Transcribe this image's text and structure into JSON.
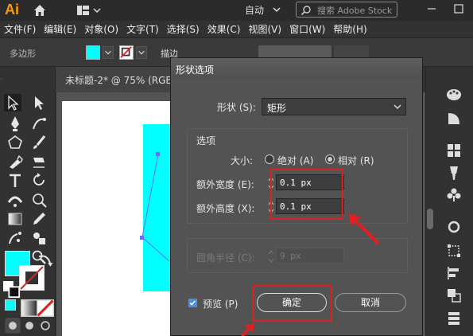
{
  "app": {
    "logo": "Ai",
    "workspace": "自动",
    "search_placeholder": "搜索 Adobe Stock"
  },
  "menu": [
    "文件(F)",
    "编辑(E)",
    "对象(O)",
    "文字(T)",
    "选择(S)",
    "效果(C)",
    "视图(V)",
    "窗口(W)",
    "帮助(H)"
  ],
  "control": {
    "tool_name": "多边形",
    "stroke_label": "描边"
  },
  "document": {
    "tab_title": "未标题-2* @ 75% (RGB"
  },
  "colors": {
    "fill": "#00ffff",
    "accent_annotation": "#e02020"
  },
  "dialog": {
    "title": "形状选项",
    "shape_label": "形状 (S):",
    "shape_value": "矩形",
    "options_title": "选项",
    "size_label": "大小:",
    "absolute_label": "绝对 (A)",
    "relative_label": "相对 (R)",
    "relative_selected": true,
    "extra_width_label": "额外宽度 (E):",
    "extra_width_value": "0.1 px",
    "extra_height_label": "额外高度 (X):",
    "extra_height_value": "0.1 px",
    "corner_radius_label": "圆角半径 (C):",
    "corner_radius_value": "9 px",
    "preview_label": "预览 (P)",
    "preview_checked": true,
    "ok_label": "确定",
    "cancel_label": "取消"
  }
}
